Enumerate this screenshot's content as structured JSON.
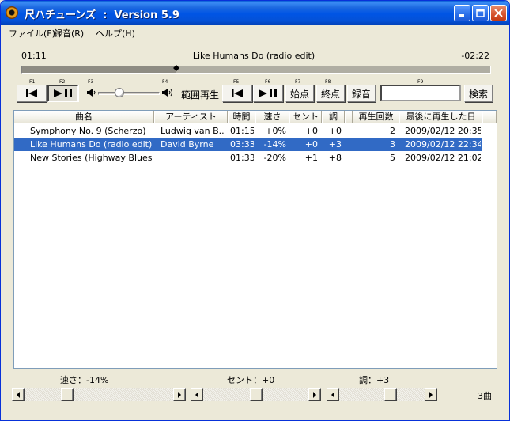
{
  "window": {
    "title": "尺ハチューンズ  :  Version 5.9"
  },
  "menu": {
    "items": [
      "ファイル(F)",
      "録音(R)",
      "ヘルプ(H)"
    ]
  },
  "player": {
    "elapsed": "01:11",
    "now_playing": "Like Humans Do (radio edit)",
    "remaining": "-02:22",
    "progress": 0.33,
    "volume": 0.35
  },
  "fkeys": {
    "f1": "F1",
    "f2": "F2",
    "f3": "F3",
    "f4": "F4",
    "f5": "F5",
    "f6": "F6",
    "f7": "F7",
    "f8": "F8",
    "f9": "F9"
  },
  "controls": {
    "range_play_label": "範囲再生",
    "start_point_label": "始点",
    "end_point_label": "終点",
    "record_label": "録音",
    "search_label": "検索",
    "search_value": ""
  },
  "list": {
    "columns": [
      "曲名",
      "アーティスト",
      "時間",
      "速さ",
      "セント",
      "調",
      "再生回数",
      "最後に再生した日"
    ],
    "rows": [
      {
        "title": "Symphony No. 9 (Scherzo)",
        "artist": "Ludwig van B...",
        "time": "01:15",
        "speed": "+0%",
        "cent": "+0",
        "key": "+0",
        "plays": "2",
        "last": "2009/02/12 20:35",
        "selected": false
      },
      {
        "title": "Like Humans Do (radio edit)",
        "artist": "David Byrne",
        "time": "03:33",
        "speed": "-14%",
        "cent": "+0",
        "key": "+3",
        "plays": "3",
        "last": "2009/02/12 22:34",
        "selected": true
      },
      {
        "title": "New Stories (Highway Blues)...",
        "artist": "",
        "time": "01:33",
        "speed": "-20%",
        "cent": "+1",
        "key": "+8",
        "plays": "5",
        "last": "2009/02/12 21:02",
        "selected": false
      }
    ]
  },
  "bottom": {
    "speed_label": "速さ：-14%",
    "cent_label": "セント：+0",
    "key_label": "調：+3",
    "speed_value": 0.27,
    "cent_value": 0.5,
    "key_value": 0.62,
    "track_count": "3曲"
  },
  "colors": {
    "titlebar": "#0055e5",
    "selection": "#316ac5",
    "face": "#ece9d8"
  }
}
